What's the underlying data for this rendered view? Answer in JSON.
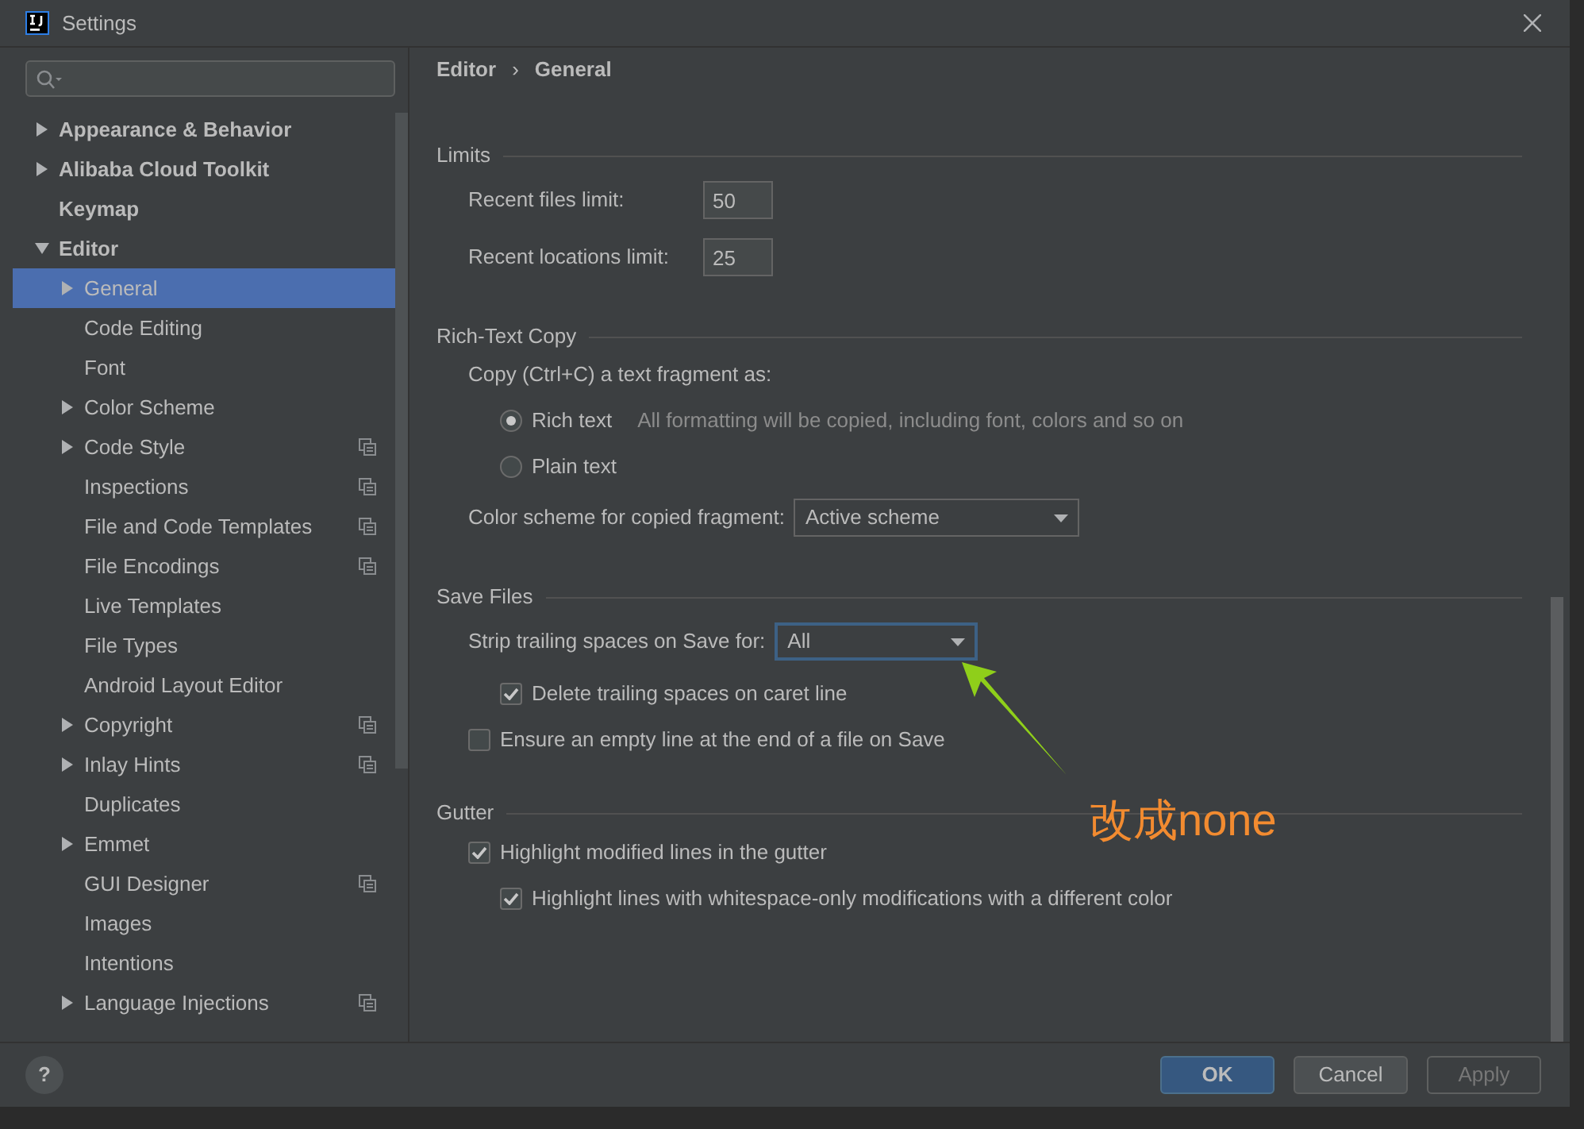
{
  "window": {
    "title": "Settings"
  },
  "sidebar": {
    "items": [
      {
        "label": "Appearance & Behavior",
        "kind": "group",
        "expanded": false,
        "selected": false,
        "shared": false
      },
      {
        "label": "Alibaba Cloud Toolkit",
        "kind": "group",
        "expanded": false,
        "selected": false,
        "shared": false
      },
      {
        "label": "Keymap",
        "kind": "leaf",
        "selected": false,
        "shared": false
      },
      {
        "label": "Editor",
        "kind": "group",
        "expanded": true,
        "selected": false,
        "shared": false,
        "children": [
          {
            "label": "General",
            "kind": "group",
            "expanded": false,
            "selected": true,
            "shared": false
          },
          {
            "label": "Code Editing",
            "kind": "leaf",
            "selected": false,
            "shared": false
          },
          {
            "label": "Font",
            "kind": "leaf",
            "selected": false,
            "shared": false
          },
          {
            "label": "Color Scheme",
            "kind": "group",
            "expanded": false,
            "selected": false,
            "shared": false
          },
          {
            "label": "Code Style",
            "kind": "group",
            "expanded": false,
            "selected": false,
            "shared": true
          },
          {
            "label": "Inspections",
            "kind": "leaf",
            "selected": false,
            "shared": true
          },
          {
            "label": "File and Code Templates",
            "kind": "leaf",
            "selected": false,
            "shared": true
          },
          {
            "label": "File Encodings",
            "kind": "leaf",
            "selected": false,
            "shared": true
          },
          {
            "label": "Live Templates",
            "kind": "leaf",
            "selected": false,
            "shared": false
          },
          {
            "label": "File Types",
            "kind": "leaf",
            "selected": false,
            "shared": false
          },
          {
            "label": "Android Layout Editor",
            "kind": "leaf",
            "selected": false,
            "shared": false
          },
          {
            "label": "Copyright",
            "kind": "group",
            "expanded": false,
            "selected": false,
            "shared": true
          },
          {
            "label": "Inlay Hints",
            "kind": "group",
            "expanded": false,
            "selected": false,
            "shared": true
          },
          {
            "label": "Duplicates",
            "kind": "leaf",
            "selected": false,
            "shared": false
          },
          {
            "label": "Emmet",
            "kind": "group",
            "expanded": false,
            "selected": false,
            "shared": false
          },
          {
            "label": "GUI Designer",
            "kind": "leaf",
            "selected": false,
            "shared": true
          },
          {
            "label": "Images",
            "kind": "leaf",
            "selected": false,
            "shared": false
          },
          {
            "label": "Intentions",
            "kind": "leaf",
            "selected": false,
            "shared": false
          },
          {
            "label": "Language Injections",
            "kind": "group",
            "expanded": false,
            "selected": false,
            "shared": true
          }
        ]
      }
    ]
  },
  "breadcrumb": [
    "Editor",
    "General"
  ],
  "breadcrumb_separator": "›",
  "sections": [
    {
      "title": "Limits",
      "rows": [
        {
          "kind": "number",
          "label": "Recent files limit:",
          "value": "50"
        },
        {
          "kind": "number",
          "label": "Recent locations limit:",
          "value": "25"
        }
      ]
    },
    {
      "title": "Rich-Text Copy",
      "rows": [
        {
          "kind": "text",
          "label": "Copy (Ctrl+C) a text fragment as:"
        },
        {
          "kind": "radio",
          "label": "Rich text",
          "hint": "All formatting will be copied, including font, colors and so on",
          "selected": true
        },
        {
          "kind": "radio",
          "label": "Plain text",
          "selected": false
        },
        {
          "kind": "dropdown",
          "label": "Color scheme for copied fragment:",
          "value": "Active scheme",
          "focused": false
        }
      ]
    },
    {
      "title": "Save Files",
      "rows": [
        {
          "kind": "dropdown",
          "label": "Strip trailing spaces on Save for:",
          "value": "All",
          "focused": true,
          "children": [
            {
              "kind": "checkbox",
              "label": "Delete trailing spaces on caret line",
              "checked": true
            }
          ]
        },
        {
          "kind": "checkbox",
          "label": "Ensure an empty line at the end of a file on Save",
          "checked": false
        }
      ]
    },
    {
      "title": "Gutter",
      "rows": [
        {
          "kind": "checkbox",
          "label": "Highlight modified lines in the gutter",
          "checked": true,
          "children": [
            {
              "kind": "checkbox",
              "label": "Highlight lines with whitespace-only modifications with a different color",
              "checked": true
            }
          ]
        }
      ]
    }
  ],
  "annotation": {
    "text": "改成none"
  },
  "help_button": "?",
  "buttons": [
    {
      "label": "OK",
      "kind": "primary",
      "disabled": false
    },
    {
      "label": "Cancel",
      "kind": "normal",
      "disabled": false
    },
    {
      "label": "Apply",
      "kind": "normal",
      "disabled": true
    }
  ]
}
